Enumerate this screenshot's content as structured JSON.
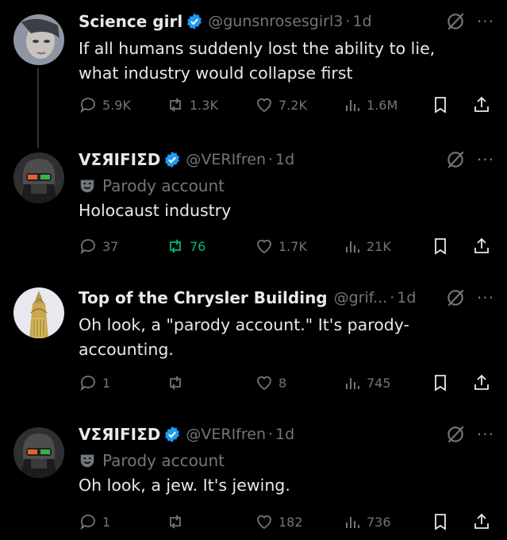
{
  "tweets": [
    {
      "name": "Science girl",
      "handle": "@gunsnrosesgirl3",
      "time": "1d",
      "parody_label": "",
      "text": "If all humans suddenly lost the ability to lie,\nwhat industry would collapse first",
      "replies": "5.9K",
      "reposts": "1.3K",
      "likes": "7.2K",
      "views": "1.6M",
      "avatar": "woman-portrait"
    },
    {
      "name": "VΣЯIFIΣD",
      "handle": "@VERIfren",
      "time": "1d",
      "parody_label": "Parody account",
      "text": "Holocaust industry",
      "replies": "37",
      "reposts": "76",
      "likes": "1.7K",
      "views": "21K",
      "avatar": "soldier-helmet"
    },
    {
      "name": "Top of the Chrysler Building",
      "handle": "@grif...",
      "time": "1d",
      "parody_label": "",
      "text": "Oh look, a \"parody account.\" It's parody-\naccounting.",
      "replies": "1",
      "reposts": "",
      "likes": "8",
      "views": "745",
      "avatar": "chrysler-building"
    },
    {
      "name": "VΣЯIFIΣD",
      "handle": "@VERIfren",
      "time": "1d",
      "parody_label": "Parody account",
      "text": "Oh look, a jew. It's jewing.",
      "replies": "1",
      "reposts": "",
      "likes": "182",
      "views": "736",
      "avatar": "soldier-helmet"
    }
  ],
  "ui": {
    "dot": "·",
    "more": "···"
  },
  "colors": {
    "background": "#000000",
    "muted": "#71767b",
    "verified": "#1d9bf0",
    "repost_active": "#00ba7c"
  }
}
